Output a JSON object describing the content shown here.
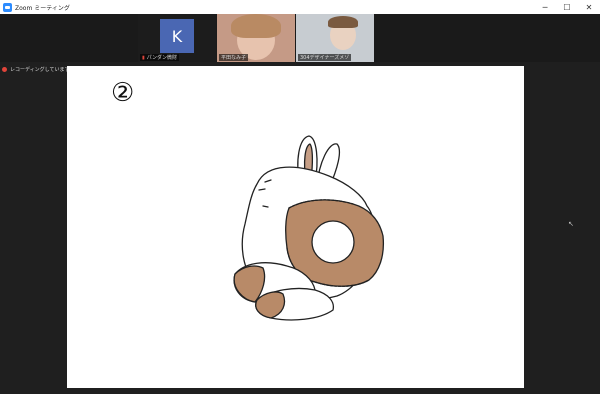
{
  "window": {
    "title": "Zoom ミーティング",
    "controls": [
      "minimize-icon",
      "maximize-icon",
      "close-icon"
    ]
  },
  "participants": [
    {
      "avatar_letter": "K",
      "name": "パンダン微財",
      "muted": true
    },
    {
      "name": "平田なみ子",
      "video": true
    },
    {
      "name": "304デザイナーズメゾ",
      "video": true
    }
  ],
  "recording": {
    "label": "レコーディングしています"
  },
  "whiteboard": {
    "step_marker": "②"
  },
  "colors": {
    "fabric": "#b88a68",
    "outline": "#222222",
    "recording": "#e0443a",
    "avatar": "#4a67b3"
  }
}
